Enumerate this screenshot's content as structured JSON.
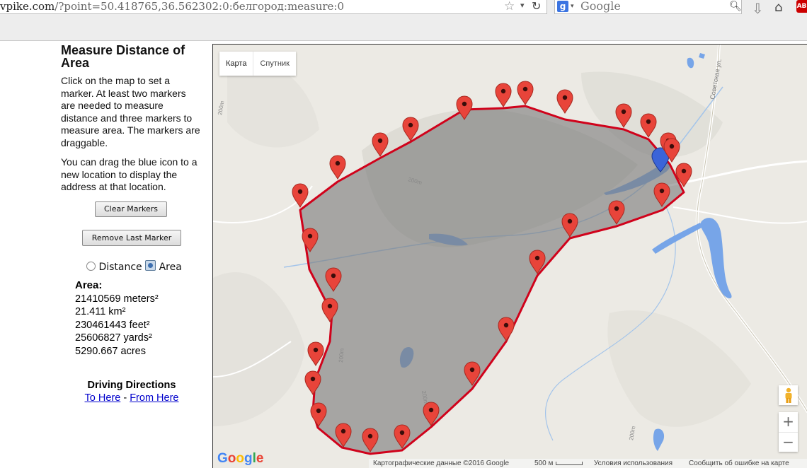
{
  "browser": {
    "url_host": "vpike.com",
    "url_path": "/?point=50.418765,36.562302:0:белгород:measure:0",
    "search_placeholder": "Google",
    "search_engine_badge": "g",
    "addon_badge": "AB"
  },
  "sidebar": {
    "title": "Measure Distance of Area",
    "instructions": "Click on the map to set a marker. At least two markers are needed to measure distance and three markers to measure area. The markers are draggable.",
    "drag_note": "You can drag the blue icon to a new location to display the address at that location.",
    "clear_button": "Clear Markers",
    "remove_button": "Remove Last Marker",
    "mode_distance": "Distance",
    "mode_area": "Area",
    "selected_mode": "Area"
  },
  "results": {
    "heading": "Area:",
    "meters": "21410569 meters²",
    "km": "21.411 km²",
    "feet": "230461443 feet²",
    "yards": "25606827 yards²",
    "acres": "5290.667 acres"
  },
  "directions": {
    "heading": "Driving Directions",
    "to_here": "To Here",
    "separator": " - ",
    "from_here": "From Here"
  },
  "map": {
    "type_map": "Карта",
    "type_satellite": "Спутник",
    "zoom_in": "+",
    "zoom_out": "−",
    "street_label": "Советская ул.",
    "contour_labels": [
      "200m",
      "200m",
      "200m",
      "200m",
      "200m"
    ],
    "attribution": "Картографические данные ©2016 Google",
    "scale": "500 м",
    "terms": "Условия использования",
    "report": "Сообщить об ошибке на карте",
    "polygon_fill": "#7a7a7a",
    "polygon_stroke": "#d0021b",
    "marker_color": "#e8443a",
    "marker_count": 25
  }
}
